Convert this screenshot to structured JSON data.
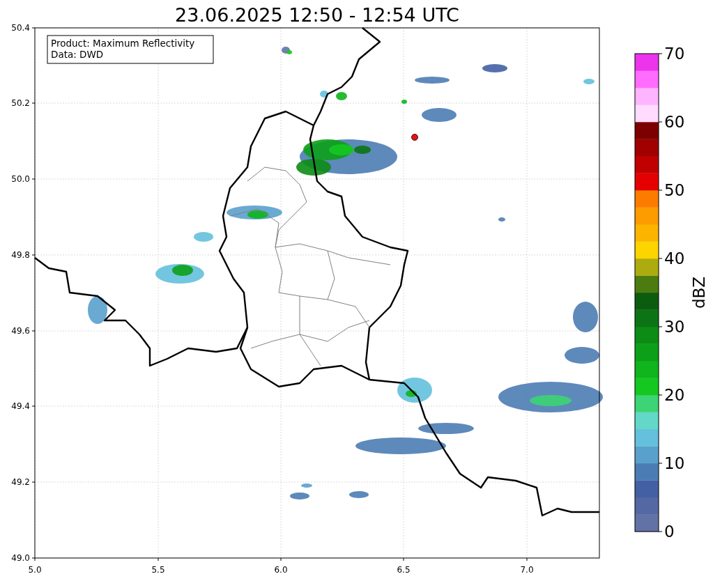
{
  "title": "23.06.2025 12:50 - 12:54 UTC",
  "info_box": [
    "Product: Maximum Reflectivity",
    "Data: DWD"
  ],
  "x_ticks": [
    "5.0",
    "5.5",
    "6.0",
    "6.5",
    "7.0"
  ],
  "y_ticks": [
    "50.4",
    "50.2",
    "50.0",
    "49.8",
    "49.6",
    "49.4",
    "49.2",
    "49.0"
  ],
  "colorbar": {
    "label": "dBZ",
    "ticks": [
      "70",
      "60",
      "50",
      "40",
      "30",
      "20",
      "10",
      "0"
    ],
    "bands": [
      {
        "color": "#6272a6"
      },
      {
        "color": "#5468a4"
      },
      {
        "color": "#4460a4"
      },
      {
        "color": "#4c7cb4"
      },
      {
        "color": "#5aa0cc"
      },
      {
        "color": "#64c0dc"
      },
      {
        "color": "#64d8c8"
      },
      {
        "color": "#3cd474"
      },
      {
        "color": "#14c820"
      },
      {
        "color": "#10b41c"
      },
      {
        "color": "#0ca018"
      },
      {
        "color": "#0c8c14"
      },
      {
        "color": "#0c7414"
      },
      {
        "color": "#0c5c10"
      },
      {
        "color": "#4c7c10"
      },
      {
        "color": "#acac10"
      },
      {
        "color": "#fcd400"
      },
      {
        "color": "#fcb400"
      },
      {
        "color": "#fc9c00"
      },
      {
        "color": "#fc7c00"
      },
      {
        "color": "#e40000"
      },
      {
        "color": "#c00000"
      },
      {
        "color": "#a00000"
      },
      {
        "color": "#7c0000"
      },
      {
        "color": "#ffdcff"
      },
      {
        "color": "#ffb4ff"
      },
      {
        "color": "#ff6cff"
      },
      {
        "color": "#ec34ec"
      }
    ]
  }
}
